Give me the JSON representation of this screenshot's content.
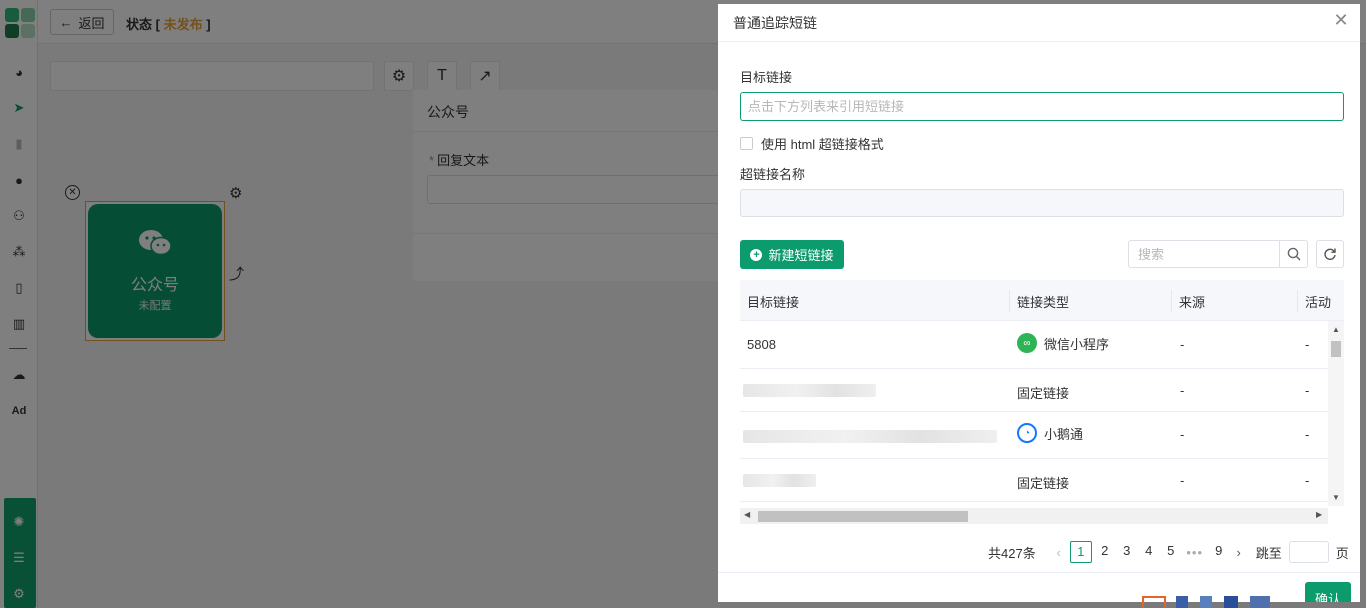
{
  "topbar": {
    "back_label": "返回",
    "status_label": "状态",
    "status_value": "未发布"
  },
  "rail": {
    "logo_colors": [
      "#2db87d",
      "#8bd3a8",
      "#1f7a4d",
      "#b9e3c8"
    ],
    "icons": [
      "dashboard-icon",
      "send-icon",
      "user-icon",
      "users-icon",
      "group-icon",
      "bookmark-icon",
      "chart-icon",
      "wechat-icon",
      "ad-icon"
    ],
    "ad_label": "Ad"
  },
  "canvas": {
    "node_title": "公众号",
    "node_subtitle": "未配置"
  },
  "reply_panel": {
    "title": "公众号",
    "field_label": "回复文本",
    "required_mark": "*"
  },
  "drawer": {
    "title": "普通追踪短链",
    "target_link_label": "目标链接",
    "target_link_placeholder": "点击下方列表来引用短链接",
    "target_link_value": "",
    "html_checkbox_label": "使用 html 超链接格式",
    "html_checkbox_checked": false,
    "link_name_label": "超链接名称",
    "link_name_value": "",
    "new_button_label": "新建短链接",
    "search_placeholder": "搜索",
    "search_value": "",
    "confirm_label": "确认"
  },
  "table": {
    "columns": [
      "目标链接",
      "链接类型",
      "来源",
      "活动"
    ],
    "rows": [
      {
        "target": "5808",
        "type": "微信小程序",
        "type_icon": "wechat-miniprogram-icon",
        "source": "-",
        "campaign": "-"
      },
      {
        "target": "",
        "type": "固定链接",
        "type_icon": "",
        "source": "-",
        "campaign": "-"
      },
      {
        "target": "",
        "type": "小鹅通",
        "type_icon": "xiaoe-icon",
        "source": "-",
        "campaign": "-"
      },
      {
        "target": "",
        "type": "固定链接",
        "type_icon": "",
        "source": "-",
        "campaign": "-"
      }
    ]
  },
  "pagination": {
    "total_label": "共427条",
    "pages": [
      "1",
      "2",
      "3",
      "4",
      "5"
    ],
    "last_page": "9",
    "current_page": "1",
    "jump_label": "跳至",
    "page_unit": "页",
    "jump_value": ""
  },
  "colors": {
    "brand": "#0c9b6c",
    "warning": "#e6a23c",
    "required": "#f56c6c",
    "miniprogram": "#2fb455",
    "xiaoe": "#1677ff"
  }
}
